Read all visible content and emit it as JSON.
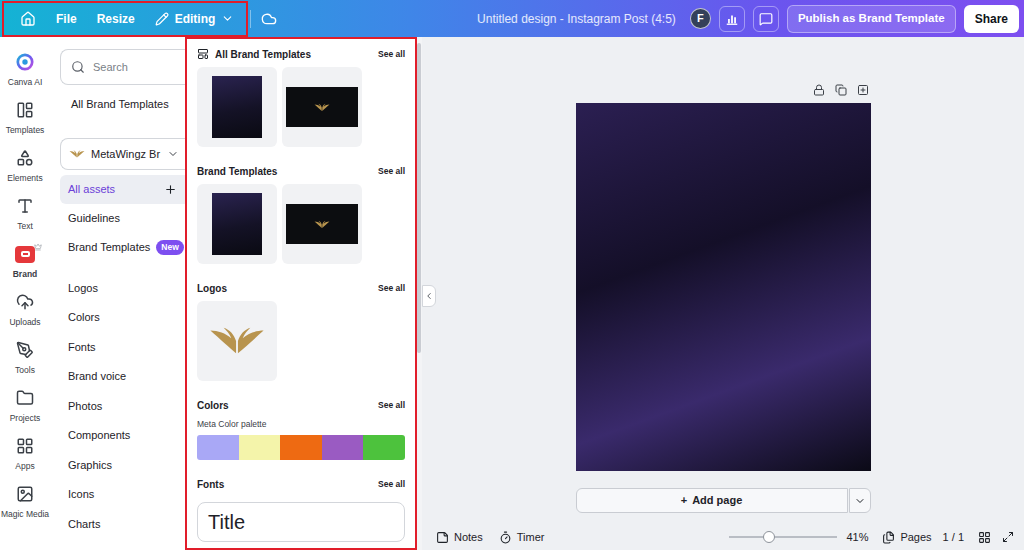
{
  "topbar": {
    "highlight": true,
    "menu": [
      {
        "label": "File",
        "kind": "menu"
      },
      {
        "label": "Resize",
        "kind": "menu"
      },
      {
        "label": "Editing",
        "kind": "mode"
      }
    ],
    "title": "Untitled design - Instagram Post (4:5)",
    "avatar": "F",
    "publish_button": "Publish as Brand Template",
    "share_button": "Share"
  },
  "rail": [
    {
      "label": "Canva AI",
      "selected": false,
      "pro": false
    },
    {
      "label": "Templates",
      "selected": false,
      "pro": false
    },
    {
      "label": "Elements",
      "selected": false,
      "pro": false
    },
    {
      "label": "Text",
      "selected": false,
      "pro": false
    },
    {
      "label": "Brand",
      "selected": true,
      "pro": true
    },
    {
      "label": "Uploads",
      "selected": false,
      "pro": false
    },
    {
      "label": "Tools",
      "selected": false,
      "pro": false
    },
    {
      "label": "Projects",
      "selected": false,
      "pro": false
    },
    {
      "label": "Apps",
      "selected": false,
      "pro": false
    },
    {
      "label": "Magic Media",
      "selected": false,
      "pro": false
    }
  ],
  "brand_nav": {
    "search_placeholder": "Search",
    "all_templates_link": "All Brand Templates",
    "brand_kit": "MetaWingz Br",
    "items": [
      {
        "label": "All assets",
        "selected": true,
        "add_button": true
      },
      {
        "label": "Guidelines",
        "selected": false,
        "add_button": false
      },
      {
        "label": "Brand Templates",
        "selected": false,
        "add_button": false,
        "badge": "New"
      }
    ],
    "asset_types": [
      {
        "label": "Logos"
      },
      {
        "label": "Colors"
      },
      {
        "label": "Fonts"
      },
      {
        "label": "Brand voice"
      },
      {
        "label": "Photos"
      },
      {
        "label": "Components"
      },
      {
        "label": "Graphics"
      },
      {
        "label": "Icons"
      },
      {
        "label": "Charts"
      }
    ]
  },
  "assets_panel": {
    "highlight": true,
    "sections": [
      {
        "kind": "templates",
        "title": "All Brand Templates",
        "see_all": "See all",
        "title_icon": true,
        "thumbnails": [
          {
            "kind": "portrait"
          },
          {
            "kind": "landscape"
          }
        ]
      },
      {
        "kind": "templates",
        "title": "Brand Templates",
        "see_all": "See all",
        "title_icon": false,
        "thumbnails": [
          {
            "kind": "portrait"
          },
          {
            "kind": "landscape"
          }
        ]
      },
      {
        "kind": "logos",
        "title": "Logos",
        "see_all": "See all",
        "title_icon": false
      },
      {
        "kind": "colors",
        "title": "Colors",
        "see_all": "See all",
        "title_icon": false,
        "palette_name": "Meta Color palette",
        "swatches": [
          {
            "color": "#a9a8f6"
          },
          {
            "color": "#f4f4aa"
          },
          {
            "color": "#ee6a12"
          },
          {
            "color": "#9a5bc2"
          },
          {
            "color": "#4dc23d"
          }
        ]
      },
      {
        "kind": "fonts",
        "title": "Fonts",
        "see_all": "See all",
        "title_icon": false,
        "samples": [
          {
            "label": "Title"
          }
        ]
      }
    ]
  },
  "add_page": {
    "icon": "+",
    "label": "Add page"
  },
  "bottom_bar": {
    "notes": "Notes",
    "timer": "Timer",
    "zoom": {
      "level": 0.37,
      "reading": "41%"
    },
    "pages": "Pages",
    "page_count": "1 / 1"
  }
}
